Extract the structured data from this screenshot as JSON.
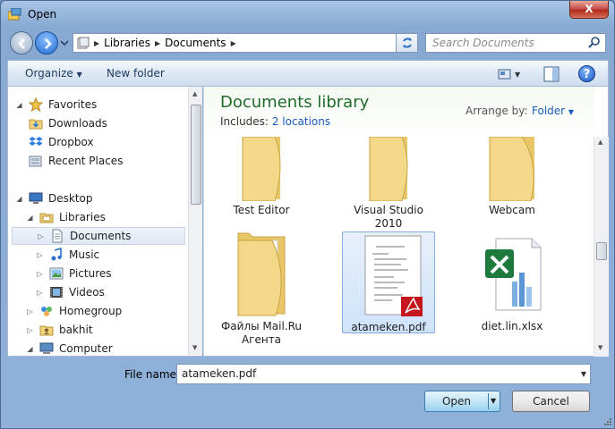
{
  "window": {
    "title": "Open",
    "close_label": "X"
  },
  "address": {
    "crumbs": [
      "Libraries",
      "Documents"
    ]
  },
  "search": {
    "placeholder": "Search Documents"
  },
  "toolbar": {
    "organize_label": "Organize",
    "new_folder_label": "New folder",
    "help_label": "?"
  },
  "nav": {
    "items": [
      {
        "label": "Favorites",
        "icon": "star-icon"
      },
      {
        "label": "Downloads",
        "icon": "downloads-folder-icon"
      },
      {
        "label": "Dropbox",
        "icon": "dropbox-icon"
      },
      {
        "label": "Recent Places",
        "icon": "recent-places-icon"
      },
      {
        "label": "Desktop",
        "icon": "desktop-icon"
      },
      {
        "label": "Libraries",
        "icon": "libraries-icon"
      },
      {
        "label": "Documents",
        "icon": "documents-icon"
      },
      {
        "label": "Music",
        "icon": "music-icon"
      },
      {
        "label": "Pictures",
        "icon": "pictures-icon"
      },
      {
        "label": "Videos",
        "icon": "videos-icon"
      },
      {
        "label": "Homegroup",
        "icon": "homegroup-icon"
      },
      {
        "label": "bakhit",
        "icon": "user-icon"
      },
      {
        "label": "Computer",
        "icon": "computer-icon"
      }
    ]
  },
  "library": {
    "title": "Documents library",
    "includes_label": "Includes:",
    "includes_link": "2 locations",
    "arrange_label": "Arrange by:",
    "arrange_value": "Folder"
  },
  "files": [
    {
      "name": "Test Editor",
      "kind": "folder"
    },
    {
      "name": "Visual Studio 2010",
      "kind": "folder"
    },
    {
      "name": "Webcam",
      "kind": "folder"
    },
    {
      "name": "Файлы Mail.Ru Агента",
      "kind": "folder"
    },
    {
      "name": "atameken.pdf",
      "kind": "pdf",
      "selected": true
    },
    {
      "name": "diet.lin.xlsx",
      "kind": "xlsx"
    }
  ],
  "filename": {
    "label": "File name:",
    "value": "atameken.pdf"
  },
  "buttons": {
    "open_label": "Open",
    "cancel_label": "Cancel"
  },
  "colors": {
    "accent": "#1a5bbf",
    "library_title": "#1e6b2a",
    "folder": "#f2d27a"
  }
}
